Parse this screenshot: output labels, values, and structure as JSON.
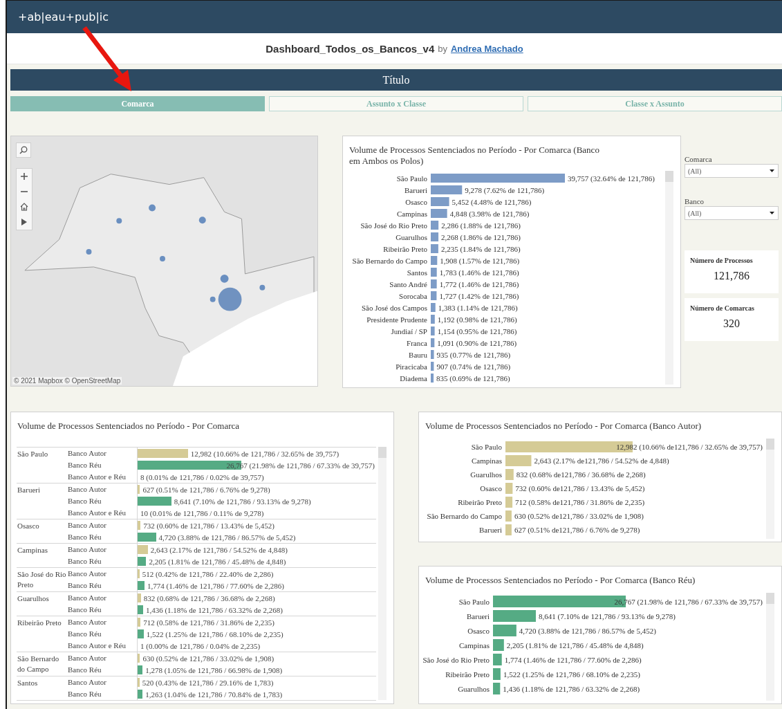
{
  "header": {
    "logo": "+ab|eau+pub|ic"
  },
  "workbook": {
    "title": "Dashboard_Todos_os_Bancos_v4",
    "by": "by",
    "author": "Andrea Machado"
  },
  "dashboard_title": "Título",
  "tabs": [
    {
      "label": "Comarca",
      "selected": true
    },
    {
      "label": "Assunto x Classe",
      "selected": false
    },
    {
      "label": "Classe x Assunto",
      "selected": false
    }
  ],
  "map": {
    "kind": "picture",
    "attribution": "© 2021 Mapbox © OpenStreetMap"
  },
  "volume_chart": {
    "title": "Volume de Processos Sentenciados no Período - Por Comarca (Banco em Ambos os Polos)",
    "chart_data": {
      "type": "bar",
      "orientation": "horizontal",
      "categories": [
        "São Paulo",
        "Barueri",
        "Osasco",
        "Campinas",
        "São José do Rio Preto",
        "Guarulhos",
        "Ribeirão Preto",
        "São Bernardo do Campo",
        "Santos",
        "Santo André",
        "Sorocaba",
        "São José dos Campos",
        "Presidente Prudente",
        "Jundiaí / SP",
        "Franca",
        "Bauru",
        "Piracicaba",
        "Diadema"
      ],
      "values": [
        39757,
        9278,
        5452,
        4848,
        2286,
        2268,
        2235,
        1908,
        1783,
        1772,
        1727,
        1383,
        1192,
        1154,
        1091,
        935,
        907,
        835
      ],
      "value_labels": [
        "39,757 (32.64% de 121,786)",
        "9,278 (7.62% de 121,786)",
        "5,452 (4.48% de 121,786)",
        "4,848 (3.98% de 121,786)",
        "2,286 (1.88% de 121,786)",
        "2,268 (1.86% de 121,786)",
        "2,235 (1.84% de 121,786)",
        "1,908 (1.57% de 121,786)",
        "1,783 (1.46% de 121,786)",
        "1,772 (1.46% de 121,786)",
        "1,727 (1.42% de 121,786)",
        "1,383 (1.14% de 121,786)",
        "1,192 (0.98% de 121,786)",
        "1,154 (0.95% de 121,786)",
        "1,091 (0.90% de 121,786)",
        "935 (0.77% de 121,786)",
        "907 (0.74% de 121,786)",
        "835 (0.69% de 121,786)"
      ]
    }
  },
  "filters": [
    {
      "label": "Comarca",
      "value": "(All)"
    },
    {
      "label": "Banco",
      "value": "(All)"
    }
  ],
  "kpis": [
    {
      "label": "Número de Processos",
      "value": "121,786"
    },
    {
      "label": "Número de Comarcas",
      "value": "320"
    }
  ],
  "table": {
    "title": "Volume de Processos Sentenciados no Período - Por Comarca",
    "groups": [
      {
        "comarca": "São Paulo",
        "rows": [
          {
            "banco": "Banco Autor",
            "level": 0.211,
            "color": "#d5cb96",
            "reading": "12,982 (10.66% de 121,786 / 32.65% de 39,757)"
          },
          {
            "banco": "Banco Réu",
            "level": 0.436,
            "color": "#55ab84",
            "reading": "26,767 (21.98% de 121,786 / 67.33% de 39,757)"
          },
          {
            "banco": "Banco Autor e Réu",
            "reading": "8 (0.01% de 121,786 / 0.02% de 39,757)"
          }
        ]
      },
      {
        "comarca": "Barueri",
        "rows": [
          {
            "banco": "Banco Autor",
            "level": 0.01,
            "color": "#d5cb96",
            "reading": "627 (0.51% de 121,786 / 6.76% de 9,278)"
          },
          {
            "banco": "Banco Réu",
            "level": 0.141,
            "color": "#55ab84",
            "reading": "8,641 (7.10% de 121,786 / 93.13% de 9,278)"
          },
          {
            "banco": "Banco Autor e Réu",
            "reading": "10 (0.01% de 121,786 / 0.11% de 9,278)"
          }
        ]
      },
      {
        "comarca": "Osasco",
        "rows": [
          {
            "banco": "Banco Autor",
            "level": 0.012,
            "color": "#d5cb96",
            "reading": "732 (0.60% de 121,786 / 13.43% de 5,452)"
          },
          {
            "banco": "Banco Réu",
            "level": 0.077,
            "color": "#55ab84",
            "reading": "4,720 (3.88% de 121,786 / 86.57% de 5,452)"
          }
        ]
      },
      {
        "comarca": "Campinas",
        "rows": [
          {
            "banco": "Banco Autor",
            "level": 0.043,
            "color": "#d5cb96",
            "reading": "2,643 (2.17% de 121,786 / 54.52% de 4,848)"
          },
          {
            "banco": "Banco Réu",
            "level": 0.036,
            "color": "#55ab84",
            "reading": "2,205 (1.81% de 121,786 / 45.48% de 4,848)"
          }
        ]
      },
      {
        "comarca": "São José do Rio Preto",
        "rows": [
          {
            "banco": "Banco Autor",
            "level": 0.008,
            "color": "#d5cb96",
            "reading": "512 (0.42% de 121,786 / 22.40% de 2,286)"
          },
          {
            "banco": "Banco Réu",
            "level": 0.029,
            "color": "#55ab84",
            "reading": "1,774 (1.46% de 121,786 / 77.60% de 2,286)"
          }
        ]
      },
      {
        "comarca": "Guarulhos",
        "rows": [
          {
            "banco": "Banco Autor",
            "level": 0.014,
            "color": "#d5cb96",
            "reading": "832 (0.68% de 121,786 / 36.68% de 2,268)"
          },
          {
            "banco": "Banco Réu",
            "level": 0.023,
            "color": "#55ab84",
            "reading": "1,436 (1.18% de 121,786 / 63.32% de 2,268)"
          }
        ]
      },
      {
        "comarca": "Ribeirão Preto",
        "rows": [
          {
            "banco": "Banco Autor",
            "level": 0.012,
            "color": "#d5cb96",
            "reading": "712 (0.58% de 121,786 / 31.86% de 2,235)"
          },
          {
            "banco": "Banco Réu",
            "level": 0.025,
            "color": "#55ab84",
            "reading": "1,522 (1.25% de 121,786 / 68.10% de 2,235)"
          },
          {
            "banco": "Banco Autor e Réu",
            "reading": "1 (0.00% de 121,786 / 0.04% de 2,235)"
          }
        ]
      },
      {
        "comarca": "São Bernardo do Campo",
        "rows": [
          {
            "banco": "Banco Autor",
            "level": 0.01,
            "color": "#d5cb96",
            "reading": "630 (0.52% de 121,786 / 33.02% de 1,908)"
          },
          {
            "banco": "Banco Réu",
            "level": 0.021,
            "color": "#55ab84",
            "reading": "1,278 (1.05% de 121,786 / 66.98% de 1,908)"
          }
        ]
      },
      {
        "comarca": "Santos",
        "rows": [
          {
            "banco": "Banco Autor",
            "level": 0.008,
            "color": "#d5cb96",
            "reading": "520 (0.43% de 121,786 / 29.16% de 1,783)"
          },
          {
            "banco": "Banco Réu",
            "level": 0.021,
            "color": "#55ab84",
            "reading": "1,263 (1.04% de 121,786 / 70.84% de 1,783)"
          }
        ]
      }
    ]
  },
  "autor_chart": {
    "title": "Volume de Processos Sentenciados no Período - Por Comarca (Banco Autor)",
    "chart_data": {
      "type": "bar",
      "orientation": "horizontal",
      "categories": [
        "São Paulo",
        "Campinas",
        "Guarulhos",
        "Osasco",
        "Ribeirão Preto",
        "São Bernardo do Campo",
        "Barueri"
      ],
      "values": [
        12982,
        2643,
        832,
        732,
        712,
        630,
        627
      ],
      "value_labels": [
        "12,982 (10.66% de121,786 / 32.65% de 39,757)",
        "2,643 (2.17% de121,786 / 54.52% de 4,848)",
        "832 (0.68% de121,786 / 36.68% de 2,268)",
        "732 (0.60% de121,786 / 13.43% de 5,452)",
        "712 (0.58% de121,786 / 31.86% de 2,235)",
        "630 (0.52% de121,786 / 33.02% de 1,908)",
        "627 (0.51% de121,786 / 6.76% de 9,278)"
      ]
    }
  },
  "reu_chart": {
    "title": "Volume de Processos Sentenciados no Período - Por Comarca (Banco Réu)",
    "chart_data": {
      "type": "bar",
      "orientation": "horizontal",
      "categories": [
        "São Paulo",
        "Barueri",
        "Osasco",
        "Campinas",
        "São José do Rio Preto",
        "Ribeirão Preto",
        "Guarulhos"
      ],
      "values": [
        26767,
        8641,
        4720,
        2205,
        1774,
        1522,
        1436
      ],
      "value_labels": [
        "26,767 (21.98% de 121,786 / 67.33% de 39,757)",
        "8,641 (7.10% de 121,786 / 93.13% de 9,278)",
        "4,720 (3.88% de 121,786 / 86.57% de 5,452)",
        "2,205 (1.81% de 121,786 / 45.48% de 4,848)",
        "1,774 (1.46% de 121,786 / 77.60% de 2,286)",
        "1,522 (1.25% de 121,786 / 68.10% de 2,235)",
        "1,436 (1.18% de 121,786 / 63.32% de 2,268)"
      ]
    }
  }
}
